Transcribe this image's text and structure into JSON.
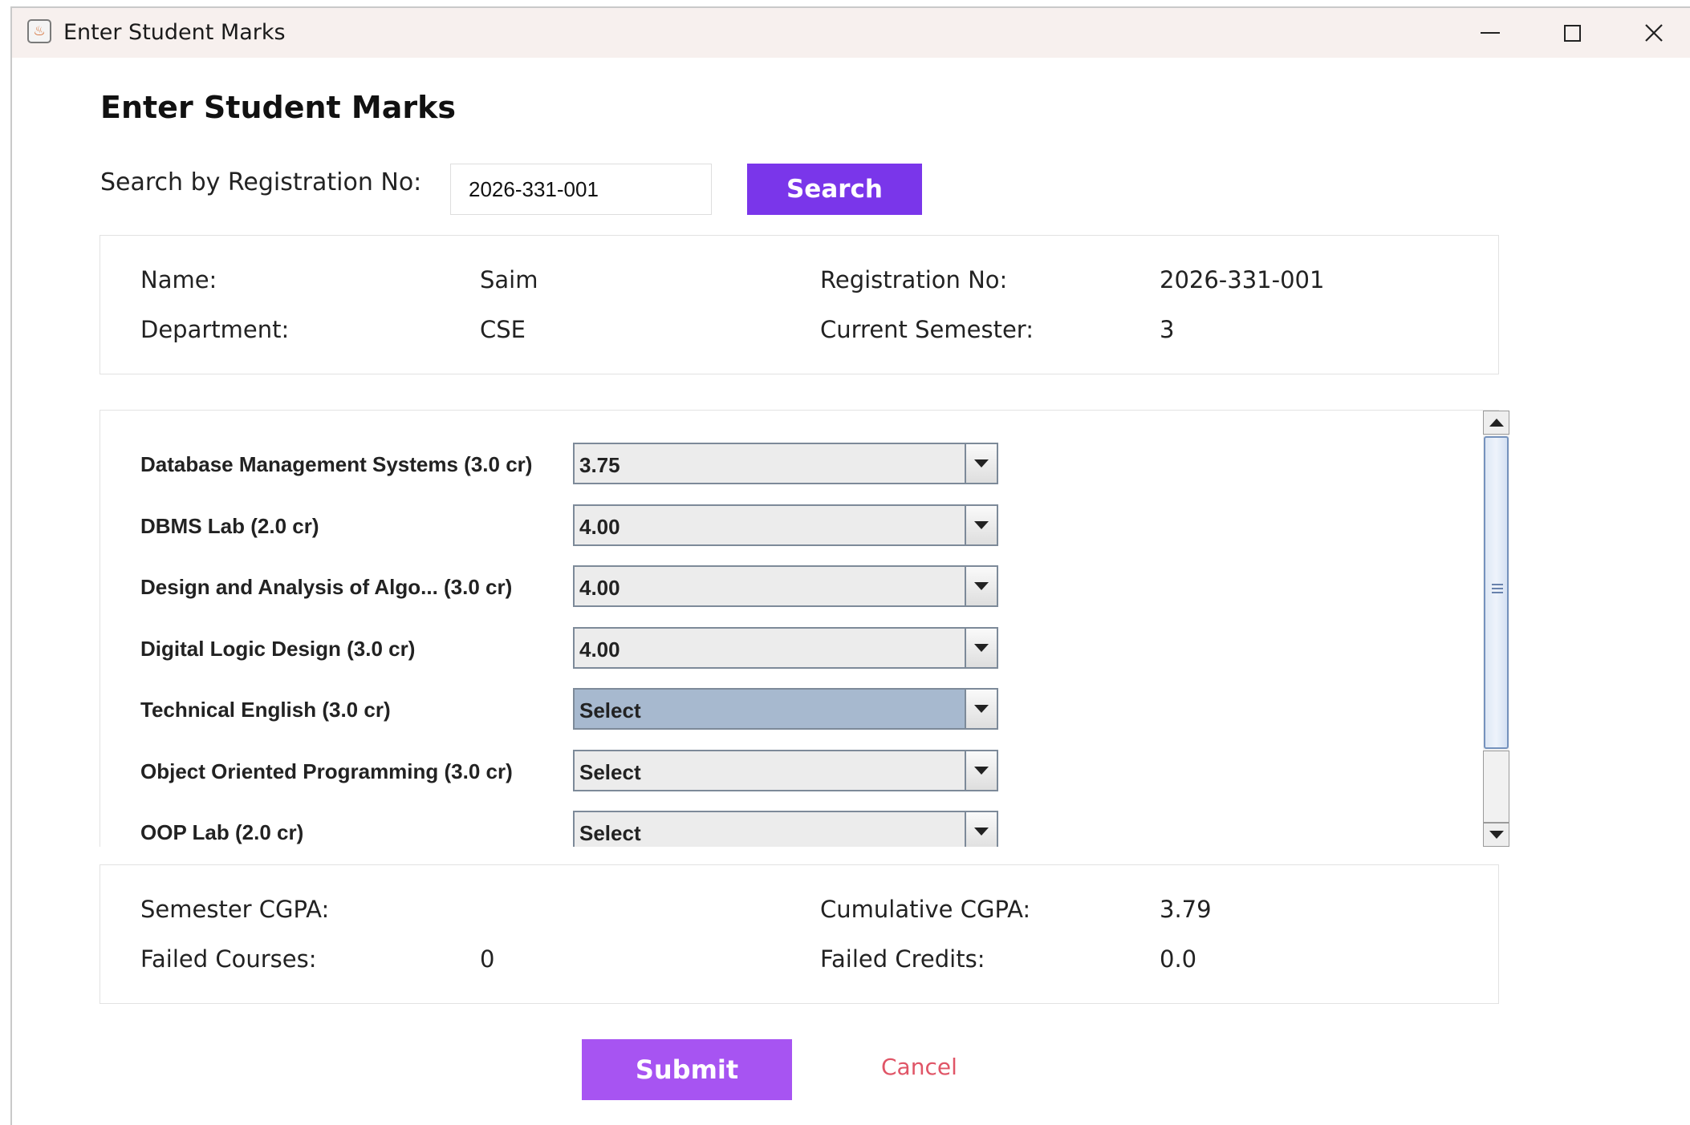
{
  "window": {
    "title": "Enter Student Marks",
    "app_icon": "java-cup-icon",
    "app_icon_glyph": "♨"
  },
  "page": {
    "heading": "Enter Student Marks"
  },
  "search": {
    "label": "Search by Registration No:",
    "value": "2026-331-001",
    "button_label": "Search",
    "button_color": "#7a36ea"
  },
  "student": {
    "name_label": "Name:",
    "name_value": "Saim",
    "reg_label": "Registration No:",
    "reg_value": "2026-331-001",
    "dept_label": "Department:",
    "dept_value": "CSE",
    "semester_label": "Current Semester:",
    "semester_value": "3"
  },
  "courses": [
    {
      "label": "Database Management Systems (3.0 cr)",
      "grade": "3.75",
      "focused": false
    },
    {
      "label": "DBMS Lab (2.0 cr)",
      "grade": "4.00",
      "focused": false
    },
    {
      "label": "Design and Analysis of Algo... (3.0 cr)",
      "grade": "4.00",
      "focused": false
    },
    {
      "label": "Digital Logic Design (3.0 cr)",
      "grade": "4.00",
      "focused": false
    },
    {
      "label": "Technical English (3.0 cr)",
      "grade": "Select",
      "focused": true
    },
    {
      "label": "Object Oriented Programming (3.0 cr)",
      "grade": "Select",
      "focused": false
    },
    {
      "label": "OOP Lab (2.0 cr)",
      "grade": "Select",
      "focused": false
    }
  ],
  "summary": {
    "semester_cgpa_label": "Semester CGPA:",
    "semester_cgpa_value": "",
    "cumulative_cgpa_label": "Cumulative CGPA:",
    "cumulative_cgpa_value": "3.79",
    "failed_courses_label": "Failed Courses:",
    "failed_courses_value": "0",
    "failed_credits_label": "Failed Credits:",
    "failed_credits_value": "0.0"
  },
  "actions": {
    "submit_label": "Submit",
    "submit_color": "#a754f2",
    "cancel_label": "Cancel",
    "cancel_color": "#e05567"
  }
}
